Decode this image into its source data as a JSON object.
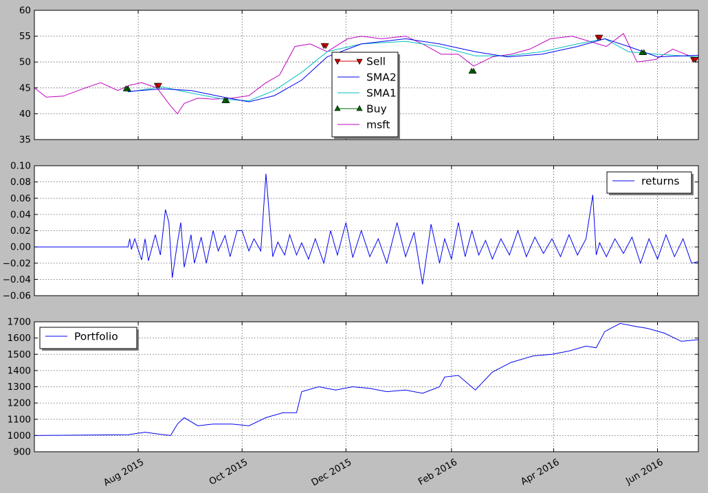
{
  "figure": {
    "background": "#bfbfbf"
  },
  "x_ticks": [
    "Aug 2015",
    "Oct 2015",
    "Dec 2015",
    "Feb 2016",
    "Apr 2016",
    "Jun 2016"
  ],
  "chart_data": [
    {
      "type": "line",
      "panel": "price",
      "x_range": [
        "2015-06-01",
        "2016-06-25"
      ],
      "ylim": [
        35,
        60
      ],
      "yticks": [
        "35",
        "40",
        "45",
        "50",
        "55",
        "60"
      ],
      "grid": true,
      "legend_position": "center",
      "legend": [
        {
          "label": "Sell",
          "color": "#cc0000",
          "marker": "triangle-down",
          "line": true
        },
        {
          "label": "SMA2",
          "color": "#0000ee",
          "marker": "none",
          "line": true
        },
        {
          "label": "SMA1",
          "color": "#00bfbf",
          "marker": "none",
          "line": true
        },
        {
          "label": "Buy",
          "color": "#006400",
          "marker": "triangle-up",
          "line": true
        },
        {
          "label": "msft",
          "color": "#bf00bf",
          "marker": "none",
          "line": true
        }
      ],
      "series": [
        {
          "name": "msft",
          "color": "#bf00bf",
          "x": [
            "2015-06-01",
            "2015-06-08",
            "2015-06-18",
            "2015-07-01",
            "2015-07-10",
            "2015-07-20",
            "2015-07-27",
            "2015-08-03",
            "2015-08-12",
            "2015-08-20",
            "2015-08-24",
            "2015-08-28",
            "2015-09-05",
            "2015-09-14",
            "2015-09-25",
            "2015-10-05",
            "2015-10-15",
            "2015-10-23",
            "2015-11-01",
            "2015-11-10",
            "2015-11-20",
            "2015-12-02",
            "2015-12-10",
            "2015-12-22",
            "2016-01-05",
            "2016-01-15",
            "2016-01-26",
            "2016-02-05",
            "2016-02-14",
            "2016-02-25",
            "2016-03-07",
            "2016-03-18",
            "2016-03-30",
            "2016-04-12",
            "2016-04-22",
            "2016-05-02",
            "2016-05-12",
            "2016-05-20",
            "2016-05-31",
            "2016-06-10",
            "2016-06-25"
          ],
          "values": [
            45,
            43.2,
            43.4,
            45,
            46,
            44.5,
            45.5,
            46,
            45,
            41.5,
            40,
            42,
            43,
            42.8,
            43,
            43.5,
            46,
            47.5,
            53,
            53.5,
            52,
            54.5,
            55,
            54.5,
            55,
            53.5,
            51.5,
            51.5,
            49.2,
            51,
            51.5,
            52.5,
            54.5,
            55,
            54,
            53,
            55.5,
            50,
            50.5,
            52.5,
            50.5
          ]
        },
        {
          "name": "SMA1",
          "color": "#00bfbf",
          "x": [
            "2015-07-26",
            "2015-08-15",
            "2015-09-01",
            "2015-09-20",
            "2015-10-05",
            "2015-10-20",
            "2015-11-05",
            "2015-11-20",
            "2015-12-10",
            "2016-01-05",
            "2016-01-25",
            "2016-02-15",
            "2016-03-05",
            "2016-03-25",
            "2016-04-15",
            "2016-05-01",
            "2016-05-15",
            "2016-06-01",
            "2016-06-25"
          ],
          "values": [
            44.2,
            45.2,
            44,
            42.8,
            42.5,
            44.5,
            48,
            52,
            53.5,
            54,
            53,
            51.2,
            51.2,
            52,
            53.5,
            54.5,
            52,
            51.5,
            51
          ]
        },
        {
          "name": "SMA2",
          "color": "#0000ee",
          "x": [
            "2015-07-26",
            "2015-08-15",
            "2015-09-01",
            "2015-09-20",
            "2015-10-05",
            "2015-10-20",
            "2015-11-05",
            "2015-11-20",
            "2015-12-10",
            "2016-01-05",
            "2016-01-25",
            "2016-02-15",
            "2016-03-05",
            "2016-03-25",
            "2016-04-15",
            "2016-05-01",
            "2016-05-15",
            "2016-06-01",
            "2016-06-25"
          ],
          "values": [
            44.3,
            44.8,
            44.5,
            43.2,
            42.3,
            43.5,
            46.5,
            51,
            53.5,
            54.5,
            53.5,
            52,
            51,
            51.5,
            53,
            54.5,
            53,
            51,
            51.3
          ]
        },
        {
          "name": "Buy",
          "color": "#006400",
          "marker": "triangle-up",
          "x": [
            "2015-07-26",
            "2015-09-22",
            "2016-02-14",
            "2016-05-24"
          ],
          "values": [
            44.8,
            42.5,
            48.2,
            51.8
          ]
        },
        {
          "name": "Sell",
          "color": "#cc0000",
          "marker": "triangle-down",
          "x": [
            "2015-08-12",
            "2015-11-18",
            "2016-04-27",
            "2016-06-22"
          ],
          "values": [
            45.5,
            53.2,
            54.8,
            50.5
          ]
        }
      ]
    },
    {
      "type": "line",
      "panel": "returns",
      "x_range": [
        "2015-06-01",
        "2016-06-25"
      ],
      "ylim": [
        -0.06,
        0.1
      ],
      "yticks": [
        "−0.06",
        "−0.04",
        "−0.02",
        "0.00",
        "0.02",
        "0.04",
        "0.06",
        "0.08",
        "0.10"
      ],
      "grid": true,
      "legend_position": "top-right",
      "legend": [
        {
          "label": "returns",
          "color": "#0000ee",
          "marker": "none",
          "line": true
        }
      ],
      "series": [
        {
          "name": "returns",
          "color": "#0000ee",
          "x": [
            "2015-06-01",
            "2015-07-26",
            "2015-07-27",
            "2015-07-28",
            "2015-07-30",
            "2015-08-03",
            "2015-08-05",
            "2015-08-07",
            "2015-08-11",
            "2015-08-14",
            "2015-08-17",
            "2015-08-19",
            "2015-08-21",
            "2015-08-24",
            "2015-08-26",
            "2015-08-28",
            "2015-09-01",
            "2015-09-03",
            "2015-09-07",
            "2015-09-10",
            "2015-09-14",
            "2015-09-17",
            "2015-09-21",
            "2015-09-24",
            "2015-09-28",
            "2015-10-01",
            "2015-10-05",
            "2015-10-08",
            "2015-10-12",
            "2015-10-15",
            "2015-10-19",
            "2015-10-22",
            "2015-10-26",
            "2015-10-29",
            "2015-11-02",
            "2015-11-05",
            "2015-11-09",
            "2015-11-13",
            "2015-11-18",
            "2015-11-22",
            "2015-11-26",
            "2015-12-01",
            "2015-12-05",
            "2015-12-10",
            "2015-12-15",
            "2015-12-20",
            "2015-12-25",
            "2015-12-31",
            "2016-01-05",
            "2016-01-10",
            "2016-01-15",
            "2016-01-20",
            "2016-01-25",
            "2016-01-28",
            "2016-02-01",
            "2016-02-05",
            "2016-02-09",
            "2016-02-13",
            "2016-02-17",
            "2016-02-21",
            "2016-02-25",
            "2016-03-01",
            "2016-03-06",
            "2016-03-11",
            "2016-03-16",
            "2016-03-21",
            "2016-03-26",
            "2016-03-31",
            "2016-04-05",
            "2016-04-10",
            "2016-04-15",
            "2016-04-20",
            "2016-04-24",
            "2016-04-26",
            "2016-04-28",
            "2016-05-02",
            "2016-05-07",
            "2016-05-12",
            "2016-05-17",
            "2016-05-22",
            "2016-05-27",
            "2016-06-01",
            "2016-06-06",
            "2016-06-11",
            "2016-06-16",
            "2016-06-21",
            "2016-06-25"
          ],
          "values": [
            0,
            0,
            0.01,
            -0.003,
            0.01,
            -0.016,
            0.01,
            -0.017,
            0.015,
            -0.01,
            0.046,
            0.03,
            -0.038,
            0.005,
            0.03,
            -0.025,
            0.015,
            -0.02,
            0.012,
            -0.02,
            0.02,
            -0.005,
            0.014,
            -0.012,
            0.02,
            0.02,
            -0.005,
            0.01,
            -0.005,
            0.09,
            -0.012,
            0.006,
            -0.01,
            0.015,
            -0.01,
            0.005,
            -0.015,
            0.01,
            -0.02,
            0.02,
            -0.01,
            0.03,
            -0.013,
            0.02,
            -0.012,
            0.01,
            -0.02,
            0.03,
            -0.012,
            0.018,
            -0.046,
            0.028,
            -0.02,
            0.01,
            -0.015,
            0.03,
            -0.012,
            0.02,
            -0.01,
            0.008,
            -0.015,
            0.01,
            -0.01,
            0.02,
            -0.012,
            0.012,
            -0.008,
            0.01,
            -0.012,
            0.015,
            -0.01,
            0.01,
            0.064,
            -0.01,
            0.005,
            -0.012,
            0.01,
            -0.008,
            0.012,
            -0.02,
            0.01,
            -0.015,
            0.015,
            -0.012,
            0.01,
            -0.02,
            -0.018
          ]
        }
      ]
    },
    {
      "type": "line",
      "panel": "portfolio",
      "x_range": [
        "2015-06-01",
        "2016-06-25"
      ],
      "ylim": [
        900,
        1700
      ],
      "yticks": [
        "900",
        "1000",
        "1100",
        "1200",
        "1300",
        "1400",
        "1500",
        "1600",
        "1700"
      ],
      "grid": true,
      "legend_position": "top-left",
      "legend": [
        {
          "label": "Portfolio",
          "color": "#0000ee",
          "marker": "none",
          "line": true
        }
      ],
      "series": [
        {
          "name": "Portfolio",
          "color": "#0000ee",
          "x": [
            "2015-06-01",
            "2015-07-26",
            "2015-08-05",
            "2015-08-12",
            "2015-08-20",
            "2015-08-24",
            "2015-08-28",
            "2015-09-05",
            "2015-09-14",
            "2015-09-25",
            "2015-10-05",
            "2015-10-15",
            "2015-10-25",
            "2015-11-02",
            "2015-11-05",
            "2015-11-15",
            "2015-11-25",
            "2015-12-05",
            "2015-12-15",
            "2015-12-25",
            "2016-01-05",
            "2016-01-15",
            "2016-01-25",
            "2016-01-28",
            "2016-02-05",
            "2016-02-15",
            "2016-02-25",
            "2016-03-07",
            "2016-03-20",
            "2016-03-31",
            "2016-04-10",
            "2016-04-20",
            "2016-04-26",
            "2016-05-01",
            "2016-05-10",
            "2016-05-20",
            "2016-05-26",
            "2016-06-05",
            "2016-06-15",
            "2016-06-25"
          ],
          "values": [
            1000,
            1005,
            1020,
            1010,
            1000,
            1070,
            1110,
            1060,
            1070,
            1070,
            1060,
            1110,
            1140,
            1140,
            1270,
            1300,
            1280,
            1300,
            1290,
            1270,
            1280,
            1260,
            1300,
            1360,
            1370,
            1280,
            1390,
            1450,
            1490,
            1500,
            1520,
            1550,
            1540,
            1640,
            1690,
            1670,
            1660,
            1630,
            1580,
            1590
          ]
        }
      ]
    }
  ]
}
